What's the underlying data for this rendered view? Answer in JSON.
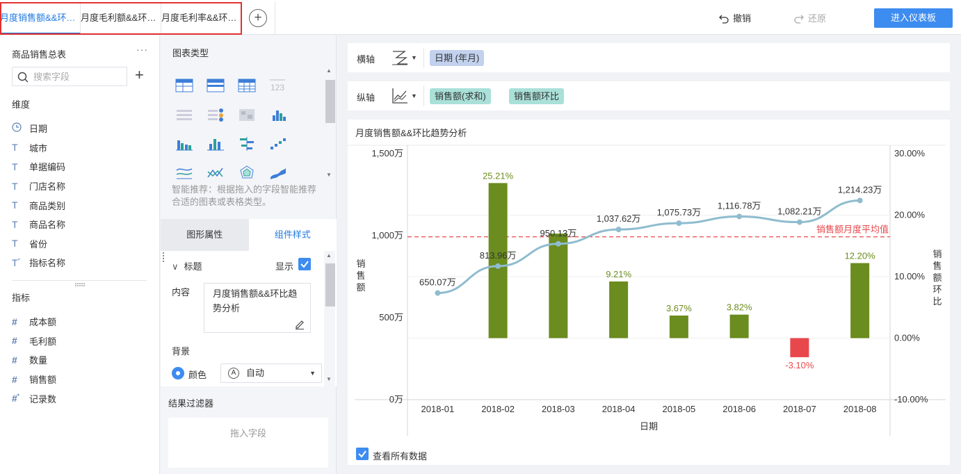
{
  "tabs": [
    {
      "label": "月度销售额&&环比趋势分析",
      "active": true
    },
    {
      "label": "月度毛利额&&环比趋势分析",
      "active": false
    },
    {
      "label": "月度毛利率&&环比趋势分析",
      "active": false
    }
  ],
  "toolbar": {
    "add_tab": "+",
    "undo": "撤销",
    "redo": "还原",
    "enter_dashboard": "进入仪表板"
  },
  "fieldpanel": {
    "table_name": "商品销售总表",
    "more": "···",
    "search_placeholder": "搜索字段",
    "dimension_label": "维度",
    "dimensions": [
      {
        "name": "日期",
        "icon": "clock-icon"
      },
      {
        "name": "城市",
        "icon": "text-field-icon"
      },
      {
        "name": "单据编码",
        "icon": "text-field-icon"
      },
      {
        "name": "门店名称",
        "icon": "text-field-icon"
      },
      {
        "name": "商品类别",
        "icon": "text-field-icon"
      },
      {
        "name": "商品名称",
        "icon": "text-field-icon"
      },
      {
        "name": "省份",
        "icon": "text-field-icon"
      },
      {
        "name": "指标名称",
        "icon": "text-field-icon"
      }
    ],
    "measure_label": "指标",
    "measures": [
      {
        "name": "成本额",
        "icon": "number-field-icon"
      },
      {
        "name": "毛利额",
        "icon": "number-field-icon"
      },
      {
        "name": "数量",
        "icon": "number-field-icon"
      },
      {
        "name": "销售额",
        "icon": "number-field-icon"
      },
      {
        "name": "记录数",
        "icon": "number-field-icon"
      }
    ]
  },
  "config": {
    "chart_type_title": "图表类型",
    "smart_tip": "智能推荐：根据拖入的字段智能推荐合适的图表或表格类型。",
    "tab_graph_props": "图形属性",
    "tab_component_style": "组件样式",
    "title_section": "标题",
    "show_label": "显示",
    "content_label": "内容",
    "content_value": "月度销售额&&环比趋势分析",
    "background_label": "背景",
    "color_label": "颜色",
    "color_value": "自动",
    "filter_title": "结果过滤器",
    "filter_placeholder": "拖入字段"
  },
  "axes": {
    "x_label": "横轴",
    "x_field": "日期 (年月)",
    "y_label": "纵轴",
    "y_fields": [
      "销售额(求和)",
      "销售额环比"
    ]
  },
  "colors": {
    "accent": "#3d8cf0",
    "bar": "#6b8c1e",
    "bar_negative": "#e8474c",
    "line": "#8fbccf",
    "avg_line": "#e8474c"
  },
  "chart_data": {
    "type": "bar",
    "title": "月度销售额&&环比趋势分析",
    "xlabel": "日期",
    "ylabel_left": "销售额",
    "ylabel_right": "销售额环比",
    "categories": [
      "2018-01",
      "2018-02",
      "2018-03",
      "2018-04",
      "2018-05",
      "2018-06",
      "2018-07",
      "2018-08"
    ],
    "left_ticks": [
      "1,500万",
      "1,000万",
      "500万",
      "0万"
    ],
    "right_ticks": [
      "30.00%",
      "20.00%",
      "10.00%",
      "0.00%",
      "-10.00%"
    ],
    "ylim_left": [
      0,
      1500
    ],
    "ylim_right": [
      -10,
      30
    ],
    "series": [
      {
        "name": "销售额环比",
        "kind": "bar",
        "values": [
          null,
          25.21,
          17.0,
          9.21,
          3.67,
          3.82,
          -3.1,
          12.2
        ],
        "labels": [
          "",
          "25.21%",
          "",
          "9.21%",
          "3.67%",
          "3.82%",
          "-3.10%",
          "12.20%"
        ]
      },
      {
        "name": "销售额(求和)",
        "kind": "line",
        "values": [
          650.07,
          813.96,
          950.13,
          1037.62,
          1075.73,
          1116.78,
          1082.21,
          1214.23
        ],
        "labels": [
          "650.07万",
          "813.96万",
          "950.13万",
          "1,037.62万",
          "1,075.73万",
          "1,116.78万",
          "1,082.21万",
          "1,214.23万"
        ]
      }
    ],
    "reference_line": {
      "label": "销售额月度平均值",
      "value": 992.59
    },
    "view_all_label": "查看所有数据"
  }
}
